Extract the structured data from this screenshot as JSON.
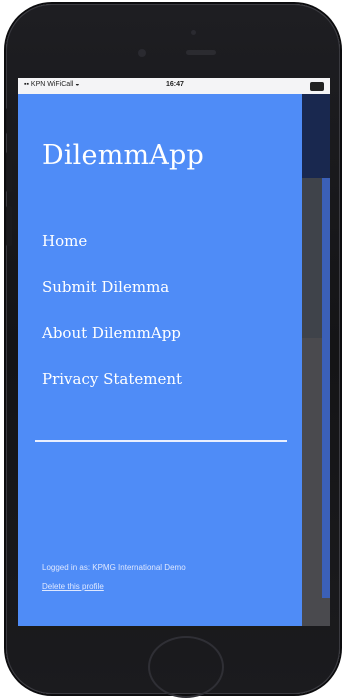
{
  "status_bar": {
    "carrier": "KPN WiFiCall",
    "time": "16:47"
  },
  "app": {
    "title": "DilemmApp"
  },
  "nav": {
    "items": [
      {
        "label": "Home"
      },
      {
        "label": "Submit Dilemma"
      },
      {
        "label": "About DilemmApp"
      },
      {
        "label": "Privacy Statement"
      }
    ]
  },
  "footer": {
    "logged_in_text": "Logged in as: KPMG International Demo",
    "delete_profile_label": "Delete this profile"
  },
  "colors": {
    "drawer": "#4f8cf7",
    "scrim": "#4a4a4e",
    "phone": "#1a1a1d"
  },
  "icons": [
    "signal-icon",
    "wifi-icon",
    "battery-icon"
  ]
}
